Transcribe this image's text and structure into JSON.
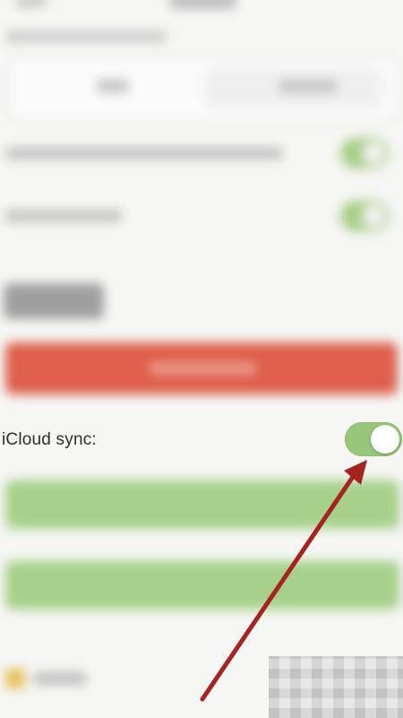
{
  "icloud_sync": {
    "label": "iCloud sync:",
    "enabled": true
  },
  "colors": {
    "toggle_on": "#98c77b",
    "destructive_button": "#dd5e4b",
    "action_button": "#a6d08a",
    "annotation_arrow": "#a52422"
  }
}
